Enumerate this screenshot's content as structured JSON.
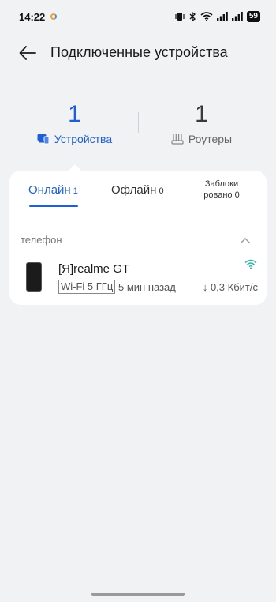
{
  "status_bar": {
    "time": "14:22",
    "battery": "59"
  },
  "header": {
    "title": "Подключенные устройства"
  },
  "summary": {
    "devices": {
      "count": "1",
      "label": "Устройства"
    },
    "routers": {
      "count": "1",
      "label": "Роутеры"
    }
  },
  "tabs": [
    {
      "label": "Онлайн",
      "count": "1"
    },
    {
      "label": "Офлайн",
      "count": "0"
    },
    {
      "label": "Заблоки\nровано",
      "count": "0"
    }
  ],
  "group": {
    "label": "телефон"
  },
  "device": {
    "name": "[Я]realme GT",
    "band": "Wi-Fi 5 ГГц",
    "last_seen": "5 мин назад",
    "speed": "↓ 0,3 Кбит/с"
  },
  "colors": {
    "accent": "#1f5fd6",
    "signal": "#2bb5a6",
    "background": "#f1f2f4"
  }
}
